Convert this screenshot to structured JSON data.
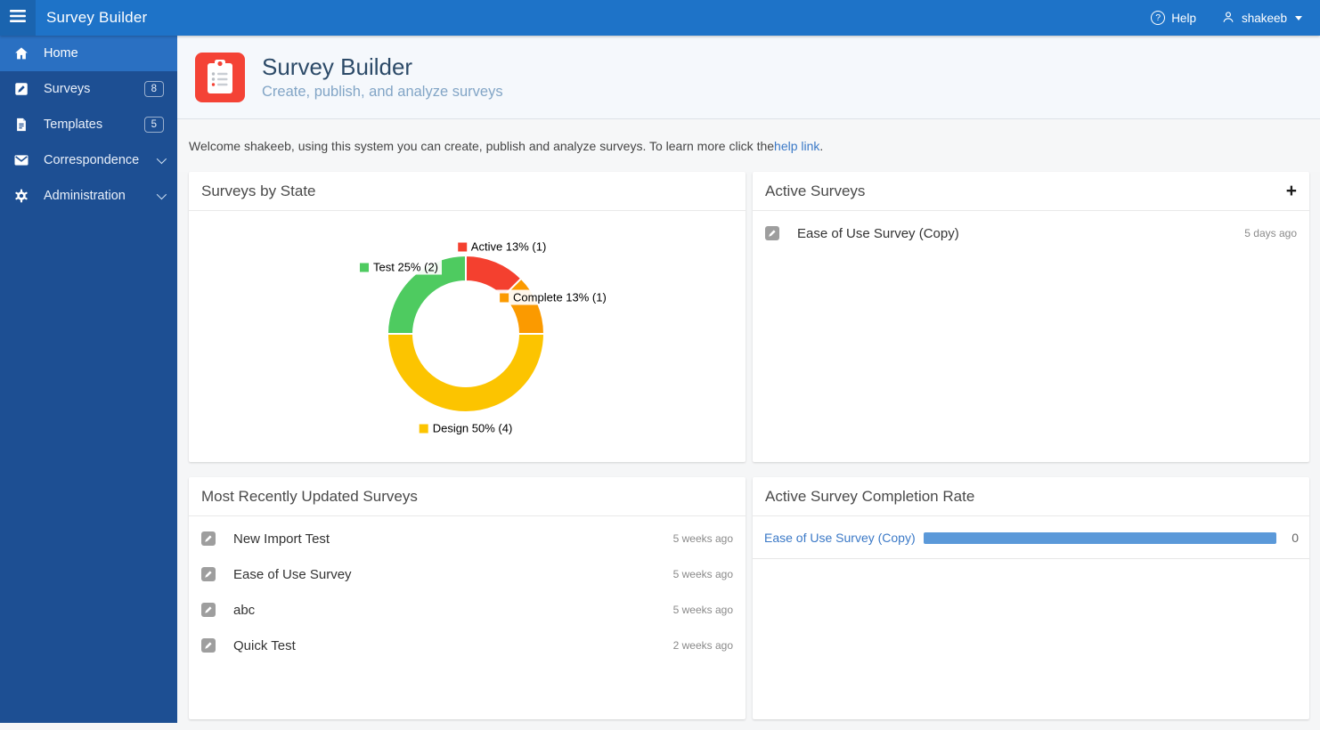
{
  "navbar": {
    "brand": "Survey Builder",
    "help_label": "Help",
    "user_name": "shakeeb"
  },
  "sidebar": {
    "items": [
      {
        "label": "Home",
        "icon": "home",
        "active": true
      },
      {
        "label": "Surveys",
        "icon": "pencil-square",
        "badge": "8"
      },
      {
        "label": "Templates",
        "icon": "file",
        "badge": "5"
      },
      {
        "label": "Correspondence",
        "icon": "envelope",
        "chevron": true
      },
      {
        "label": "Administration",
        "icon": "gear",
        "chevron": true
      }
    ]
  },
  "header": {
    "title": "Survey Builder",
    "subtitle": "Create, publish, and analyze surveys"
  },
  "welcome": {
    "text_before": "Welcome shakeeb, using this system you can create, publish and analyze surveys. To learn more click the ",
    "link": "help link",
    "text_after": "."
  },
  "panels": {
    "surveys_by_state": {
      "title": "Surveys by State"
    },
    "active_surveys": {
      "title": "Active Surveys",
      "add_label": "+",
      "items": [
        {
          "name": "Ease of Use Survey (Copy)",
          "time": "5 days ago"
        }
      ]
    },
    "recent_surveys": {
      "title": "Most Recently Updated Surveys",
      "items": [
        {
          "name": "New Import Test",
          "time": "5 weeks ago"
        },
        {
          "name": "Ease of Use Survey",
          "time": "5 weeks ago"
        },
        {
          "name": "abc",
          "time": "5 weeks ago"
        },
        {
          "name": "Quick Test",
          "time": "2 weeks ago"
        }
      ]
    },
    "completion_rate": {
      "title": "Active Survey Completion Rate",
      "rows": [
        {
          "name": "Ease of Use Survey (Copy)",
          "value": "0",
          "bar_percent": 100
        }
      ]
    }
  },
  "chart_data": {
    "type": "pie",
    "donut": true,
    "title": "Surveys by State",
    "total_surveys": 8,
    "start_angle_deg": 0,
    "direction": "clockwise",
    "segments": [
      {
        "label": "Active",
        "percent": 13,
        "count": 1,
        "color": "#f4402f"
      },
      {
        "label": "Complete",
        "percent": 13,
        "count": 1,
        "color": "#fb9a00"
      },
      {
        "label": "Design",
        "percent": 50,
        "count": 4,
        "color": "#fcc400"
      },
      {
        "label": "Test",
        "percent": 25,
        "count": 2,
        "color": "#4ecb60"
      }
    ],
    "label_format": "{label} {percent}% ({count})"
  },
  "colors": {
    "navbar_bg": "#1e73c8",
    "navbar_burger_bg": "#1a64af",
    "sidebar_bg": "#1d4f93",
    "sidebar_active_bg": "#2a70c2",
    "app_icon_bg": "#f44336",
    "page_title": "#2c4a68",
    "link": "#3b79c7",
    "progress_bar": "#5b99d9"
  }
}
